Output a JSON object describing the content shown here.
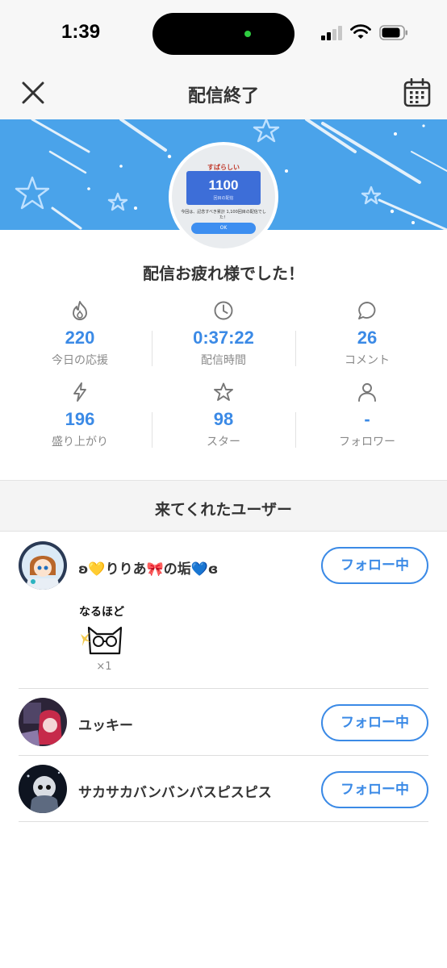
{
  "status_bar": {
    "time": "1:39"
  },
  "header": {
    "title": "配信終了"
  },
  "banner": {
    "thumbnail": {
      "top_text": "すばらしい",
      "number": "1100",
      "sub": "回目の配信",
      "text": "今回は、記念すべき累計 1,100回目の配信でした！",
      "ok": "OK"
    }
  },
  "thanks_message": "配信お疲れ様でした！",
  "stats": [
    {
      "icon": "flame-icon",
      "value": "220",
      "label": "今日の応援"
    },
    {
      "icon": "clock-icon",
      "value": "0:37:22",
      "label": "配信時間"
    },
    {
      "icon": "comment-icon",
      "value": "26",
      "label": "コメント"
    },
    {
      "icon": "lightning-icon",
      "value": "196",
      "label": "盛り上がり"
    },
    {
      "icon": "star-icon",
      "value": "98",
      "label": "スター"
    },
    {
      "icon": "person-icon",
      "value": "-",
      "label": "フォロワー"
    }
  ],
  "visitors": {
    "title": "来てくれたユーザー",
    "users": [
      {
        "name": "ʚ💛りりあ🎀の垢💙ɞ",
        "follow_label": "フォロー中",
        "gift": {
          "text": "なるほど",
          "count": "×1"
        }
      },
      {
        "name": "ユッキー",
        "follow_label": "フォロー中"
      },
      {
        "name": "サカサカバンバンバスピスピス",
        "follow_label": "フォロー中"
      }
    ]
  },
  "colors": {
    "accent": "#3b8ae6",
    "banner": "#4aa3ea"
  }
}
